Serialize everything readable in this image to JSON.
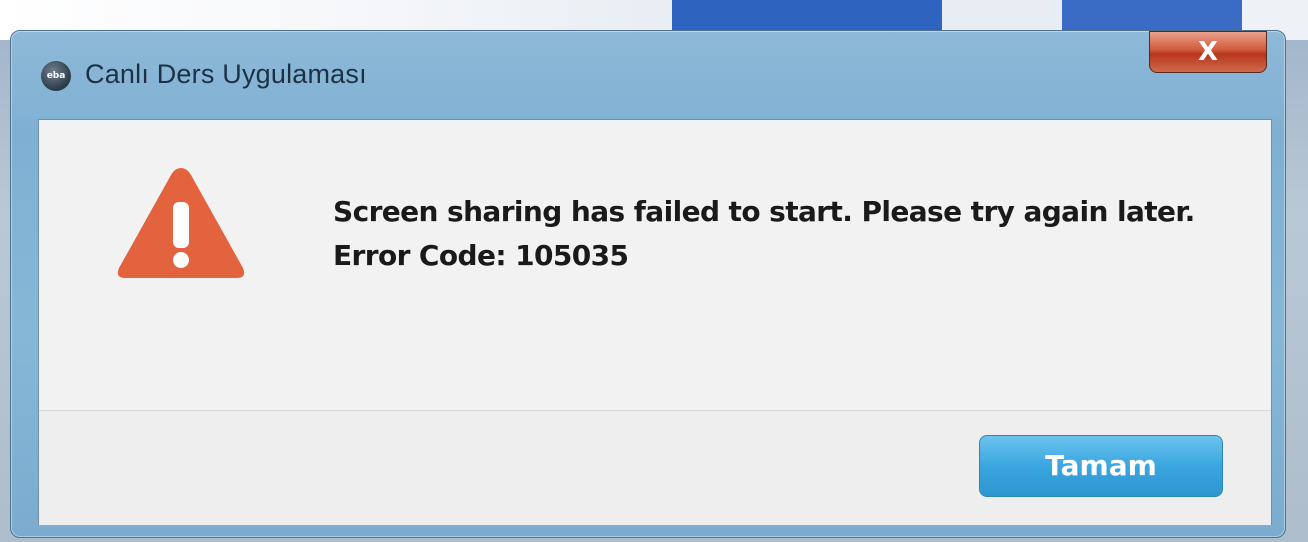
{
  "window": {
    "title": "Canlı Ders Uygulaması",
    "app_icon_label": "eba",
    "close_label": "X"
  },
  "dialog": {
    "message_line1": "Screen sharing has failed to start. Please try again later.",
    "message_line2": "Error Code: 105035",
    "ok_label": "Tamam"
  },
  "icons": {
    "warning": "warning-triangle-icon",
    "app": "app-icon",
    "close": "close-icon"
  },
  "colors": {
    "warning": "#e4633f",
    "ok_button": "#3aa6df",
    "close_button": "#c84a2c"
  }
}
